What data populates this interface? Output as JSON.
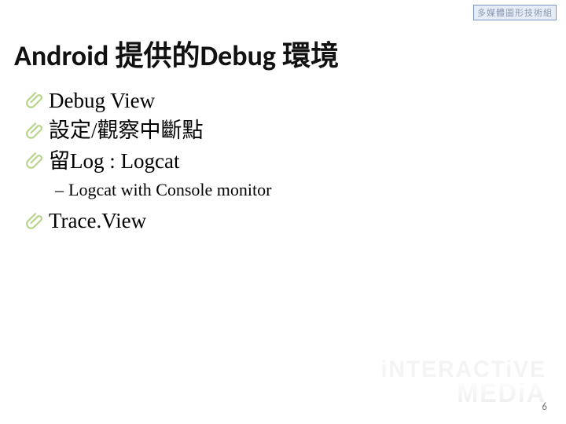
{
  "badge": "多媒體圖形技術組",
  "title": "Android 提供的Debug 環境",
  "bullets": [
    "Debug View",
    "設定/觀察中斷點",
    "留Log : Logcat"
  ],
  "subbullet": "Logcat with Console monitor",
  "bullets2": [
    "Trace.View"
  ],
  "watermark_top": "iNTERACTiVE",
  "watermark_bot": "MEDiA",
  "page_number": "6"
}
